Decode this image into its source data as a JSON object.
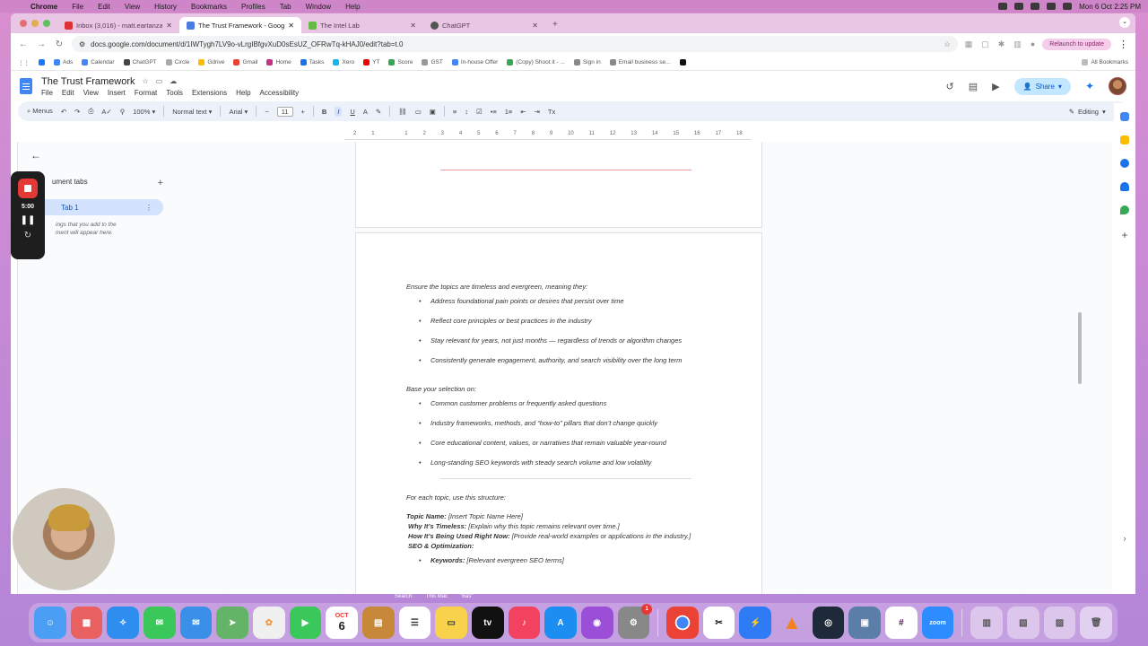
{
  "mac_menu": {
    "app": "Chrome",
    "items": [
      "File",
      "Edit",
      "View",
      "History",
      "Bookmarks",
      "Profiles",
      "Tab",
      "Window",
      "Help"
    ],
    "clock": "Mon 6 Oct  2:25 PM"
  },
  "browser": {
    "tabs": [
      {
        "title": "Inbox (3,016) - matt.eartanza",
        "active": false,
        "icon": "gmail-icon"
      },
      {
        "title": "The Trust Framework - Goog",
        "active": true,
        "icon": "docs-icon"
      },
      {
        "title": "The Intel Lab",
        "active": false,
        "icon": "site-icon"
      },
      {
        "title": "ChatGPT",
        "active": false,
        "icon": "chatgpt-icon"
      }
    ],
    "url": "docs.google.com/document/d/1IWTygh7LV9o-vLrgIBfgvXuD0sEsUZ_OFRwTq-kHAJ0/edit?tab=t.0",
    "relaunch_label": "Relaunch to update",
    "bookmarks": [
      "Ads",
      "Calendar",
      "ChatGPT",
      "Circle",
      "Gdrive",
      "Gmail",
      "Home",
      "Tasks",
      "Xero",
      "YT",
      "Score",
      "GST",
      "In-house Offer",
      "(Copy) Shoot it - ...",
      "Sign in",
      "Email business se..."
    ],
    "all_bookmarks": "All Bookmarks"
  },
  "docs": {
    "title": "The Trust Framework",
    "menus": [
      "File",
      "Edit",
      "View",
      "Insert",
      "Format",
      "Tools",
      "Extensions",
      "Help",
      "Accessibility"
    ],
    "share_label": "Share",
    "toolbar": {
      "menus_label": "Menus",
      "zoom": "100%",
      "style": "Normal text",
      "font": "Arial",
      "font_size": "11",
      "mode": "Editing"
    },
    "ruler_ticks": [
      "2",
      "1",
      "",
      "1",
      "2",
      "3",
      "4",
      "5",
      "6",
      "7",
      "8",
      "9",
      "10",
      "11",
      "12",
      "13",
      "14",
      "15",
      "16",
      "17",
      "18"
    ],
    "sidebar": {
      "heading": "ument tabs",
      "tab": "Tab 1",
      "hint": "ings that you add to the\nment will appear here."
    },
    "content": {
      "intro1": "Ensure the topics are timeless and evergreen, meaning they:",
      "list1": [
        "Address foundational pain points or desires that persist over time",
        "Reflect core principles or best practices in the industry",
        "Stay relevant for years, not just months — regardless of trends or algorithm changes",
        "Consistently generate engagement, authority, and search visibility over the long term"
      ],
      "intro2": "Base your selection on:",
      "list2": [
        "Common customer problems or frequently asked questions",
        "Industry frameworks, methods, and “how-to” pillars that don’t change quickly",
        "Core educational content, values, or narratives that remain valuable year-round",
        "Long-standing SEO keywords with steady search volume and low volatility"
      ],
      "intro3": "For each topic, use this structure:",
      "topic_name_label": "Topic Name:",
      "topic_name_value": " [Insert Topic Name Here]",
      "why_label": "Why It’s Timeless:",
      "why_value": " [Explain why this topic remains relevant over time.]",
      "how_label": "How It’s Being Used Right Now:",
      "how_value": " [Provide real-world examples or applications in the industry.]",
      "seo_label": "SEO & Optimization:",
      "keywords_label": "Keywords:",
      "keywords_value": " [Relevant evergreen SEO terms]"
    }
  },
  "recorder": {
    "time": "5:00"
  },
  "finder_bar": {
    "search": "Search:",
    "scope": "This Mac",
    "query": "\"Bas\""
  },
  "dock": {
    "apps": [
      "Finder",
      "Launchpad",
      "Safari",
      "Messages",
      "Mail",
      "Maps",
      "Photos",
      "FaceTime",
      "Calendar",
      "Notes-app",
      "Reminders",
      "Notes",
      "Apple TV",
      "Music",
      "App Store",
      "Podcasts",
      "System Settings",
      "Chrome",
      "CapCut",
      "Messenger",
      "VLC",
      "Proxy",
      "Preview",
      "Slack",
      "Zoom",
      "Trash"
    ],
    "calendar_month": "OCT",
    "calendar_day": "6",
    "settings_badge": "1",
    "zoom_label": "zoom"
  }
}
